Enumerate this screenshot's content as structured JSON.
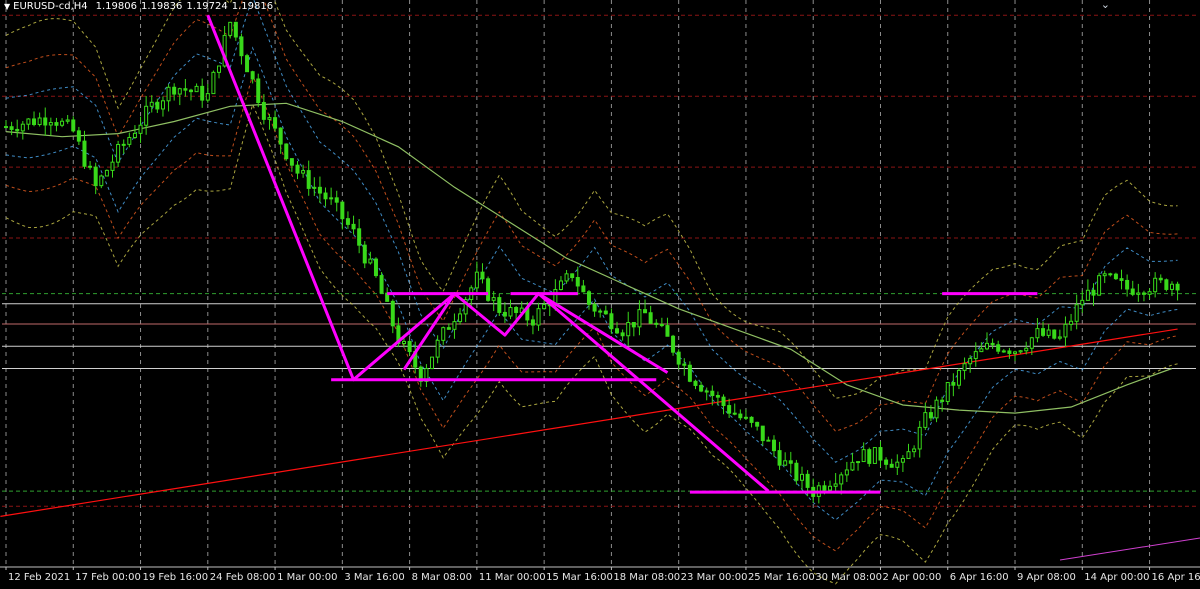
{
  "header": {
    "symbol": "EURUSD-cd,H4",
    "values": [
      "1.19806",
      "1.19836",
      "1.19724",
      "1.19816"
    ],
    "dropdown_icon": "triangle-down-icon",
    "corner_icon": "chevron-down-icon"
  },
  "colors": {
    "background": "#000000",
    "bull": "#39d91a",
    "drawn": "#ff00ff",
    "trend_red": "#ff1010",
    "ma_green": "#8fbf63",
    "band_yellow": "#c8c24a",
    "band_orange": "#e05a20",
    "band_blue": "#4aa3e6",
    "grid": "#d9d9d9",
    "level_red": "#8a1414",
    "level_white": "#d0d0d0",
    "level_green": "#2f9f2f"
  },
  "chart_data": {
    "type": "candlestick",
    "x_tick_labels": [
      "12 Feb 2021",
      "17 Feb 00:00",
      "19 Feb 16:00",
      "24 Feb 08:00",
      "1 Mar 00:00",
      "3 Mar 16:00",
      "8 Mar 08:00",
      "11 Mar 00:00",
      "15 Mar 16:00",
      "18 Mar 08:00",
      "23 Mar 00:00",
      "25 Mar 16:00",
      "30 Mar 08:00",
      "2 Apr 00:00",
      "6 Apr 16:00",
      "9 Apr 08:00",
      "14 Apr 00:00",
      "16 Apr 16:00"
    ],
    "x_tick_index": [
      0,
      12,
      24,
      36,
      48,
      60,
      72,
      84,
      96,
      108,
      120,
      132,
      144,
      156,
      168,
      180,
      192,
      204
    ],
    "bar_count": 210,
    "y_range": [
      1.17,
      1.226
    ],
    "last_ohlc": {
      "open": 1.19806,
      "high": 1.19836,
      "low": 1.19724,
      "close": 1.19816
    },
    "close_path": [
      [
        0,
        1.2135
      ],
      [
        8,
        1.2145
      ],
      [
        12,
        1.213
      ],
      [
        16,
        1.2075
      ],
      [
        20,
        1.211
      ],
      [
        26,
        1.2155
      ],
      [
        30,
        1.2175
      ],
      [
        36,
        1.2165
      ],
      [
        40,
        1.2238
      ],
      [
        43,
        1.2195
      ],
      [
        46,
        1.215
      ],
      [
        52,
        1.209
      ],
      [
        58,
        1.206
      ],
      [
        62,
        1.203
      ],
      [
        66,
        1.1985
      ],
      [
        70,
        1.1925
      ],
      [
        74,
        1.189
      ],
      [
        78,
        1.193
      ],
      [
        84,
        1.1985
      ],
      [
        88,
        1.1955
      ],
      [
        94,
        1.1945
      ],
      [
        98,
        1.197
      ],
      [
        101,
        1.199
      ],
      [
        104,
        1.196
      ],
      [
        110,
        1.1935
      ],
      [
        114,
        1.195
      ],
      [
        118,
        1.1925
      ],
      [
        122,
        1.189
      ],
      [
        128,
        1.186
      ],
      [
        134,
        1.1835
      ],
      [
        140,
        1.1795
      ],
      [
        144,
        1.1775
      ],
      [
        148,
        1.179
      ],
      [
        152,
        1.181
      ],
      [
        156,
        1.181
      ],
      [
        160,
        1.18
      ],
      [
        164,
        1.1845
      ],
      [
        168,
        1.1875
      ],
      [
        172,
        1.1905
      ],
      [
        176,
        1.192
      ],
      [
        180,
        1.1915
      ],
      [
        184,
        1.193
      ],
      [
        188,
        1.1925
      ],
      [
        192,
        1.1965
      ],
      [
        196,
        1.1985
      ],
      [
        200,
        1.1975
      ],
      [
        204,
        1.1978
      ],
      [
        209,
        1.19816
      ]
    ],
    "ma_path": [
      [
        0,
        1.213
      ],
      [
        10,
        1.2125
      ],
      [
        20,
        1.2128
      ],
      [
        30,
        1.214
      ],
      [
        40,
        1.2155
      ],
      [
        50,
        1.2158
      ],
      [
        60,
        1.214
      ],
      [
        70,
        1.2115
      ],
      [
        80,
        1.2075
      ],
      [
        90,
        1.204
      ],
      [
        100,
        1.2005
      ],
      [
        110,
        1.198
      ],
      [
        120,
        1.1955
      ],
      [
        130,
        1.1935
      ],
      [
        140,
        1.1915
      ],
      [
        150,
        1.188
      ],
      [
        160,
        1.186
      ],
      [
        170,
        1.1855
      ],
      [
        180,
        1.1852
      ],
      [
        190,
        1.1858
      ],
      [
        200,
        1.188
      ],
      [
        208,
        1.1896
      ]
    ],
    "red_trendline": [
      [
        -1,
        1.175
      ],
      [
        209,
        1.1935
      ]
    ],
    "drawn_zigzag": [
      [
        36,
        1.2245
      ],
      [
        62,
        1.1885
      ],
      [
        80,
        1.197
      ],
      [
        89,
        1.1929
      ],
      [
        96,
        1.1967
      ],
      [
        108,
        1.1919
      ],
      [
        119,
        1.1895
      ],
      [
        122,
        1.1885
      ],
      [
        136,
        1.1775
      ]
    ],
    "drawn_zigzag2": [
      [
        71,
        1.1895
      ],
      [
        80,
        1.197
      ],
      [
        89,
        1.1929
      ],
      [
        95,
        1.197
      ],
      [
        118,
        1.1892
      ]
    ],
    "drawn_horizontal": [
      {
        "from": 68,
        "to": 86,
        "y": 1.197
      },
      {
        "from": 90,
        "to": 102,
        "y": 1.197
      },
      {
        "from": 58,
        "to": 116,
        "y": 1.1885
      },
      {
        "from": 122,
        "to": 156,
        "y": 1.1774
      },
      {
        "from": 167,
        "to": 184,
        "y": 1.197
      }
    ],
    "horizontal_levels": [
      {
        "y": 1.2245,
        "style": "red-dashed"
      },
      {
        "y": 1.2165,
        "style": "red-dashed"
      },
      {
        "y": 1.2095,
        "style": "red-dashed"
      },
      {
        "y": 1.2025,
        "style": "red-dashed"
      },
      {
        "y": 1.197,
        "style": "green-dashed"
      },
      {
        "y": 1.196,
        "style": "white"
      },
      {
        "y": 1.194,
        "style": "red-solid"
      },
      {
        "y": 1.1918,
        "style": "white"
      },
      {
        "y": 1.1896,
        "style": "white"
      },
      {
        "y": 1.1775,
        "style": "green-dashed"
      },
      {
        "y": 1.176,
        "style": "red-dashed"
      }
    ],
    "grid": true
  }
}
